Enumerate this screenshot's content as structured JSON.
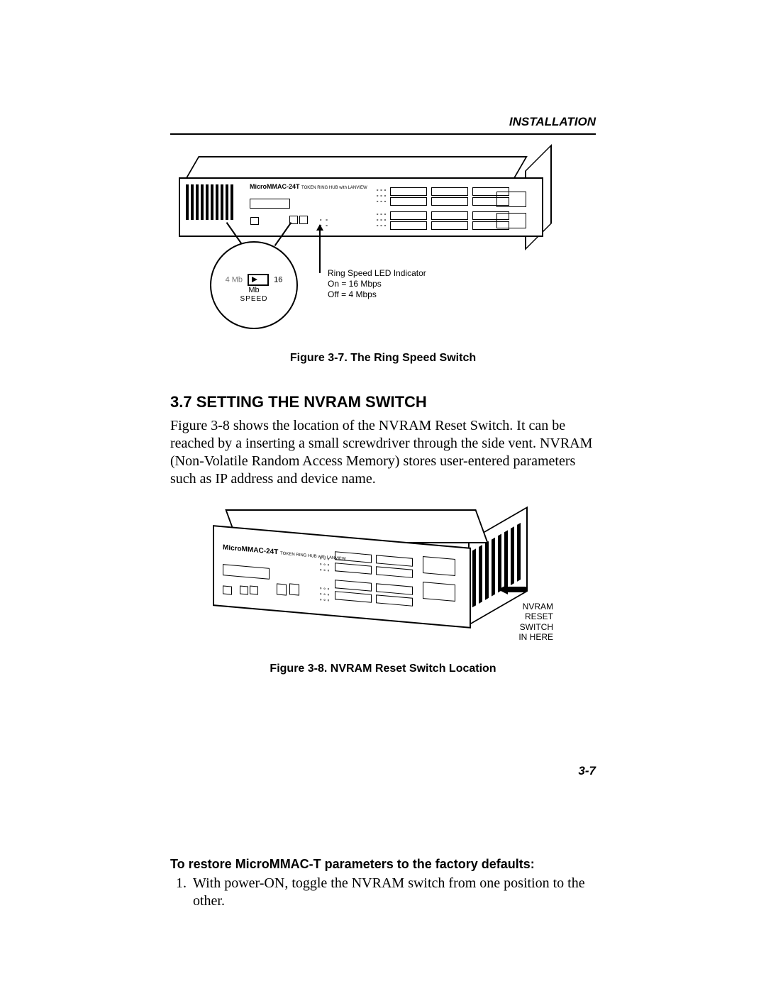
{
  "header": {
    "running_head": "INSTALLATION"
  },
  "figure1": {
    "device_model": "MicroMMAC-24T",
    "device_sub": "TOKEN RING HUB with LANVIEW",
    "mag_left": "4 Mb",
    "mag_right": "16 Mb",
    "mag_speed": "SPEED",
    "annotation_l1": "Ring Speed LED Indicator",
    "annotation_l2": "On = 16 Mbps",
    "annotation_l3": "Off = 4 Mbps",
    "caption": "Figure 3-7.  The Ring Speed Switch"
  },
  "section": {
    "heading": "3.7  SETTING THE NVRAM SWITCH",
    "para": "Figure 3-8 shows the location of the NVRAM Reset Switch. It can be reached by a inserting a small screwdriver through the side vent. NVRAM (Non-Volatile Random Access Memory) stores user-entered parameters such as IP address and device name."
  },
  "figure2": {
    "device_model": "MicroMMAC-24T",
    "device_sub": "TOKEN RING HUB with LANVIEW",
    "annotation_l1": "NVRAM",
    "annotation_l2": "RESET SWITCH",
    "annotation_l3": "IN HERE",
    "caption": "Figure 3-8.  NVRAM Reset Switch Location"
  },
  "restore": {
    "heading": "To restore MicroMMAC-T parameters to the factory defaults:",
    "step1": "With power-ON, toggle the NVRAM switch from one position to the other."
  },
  "footer": {
    "page_number": "3-7"
  }
}
